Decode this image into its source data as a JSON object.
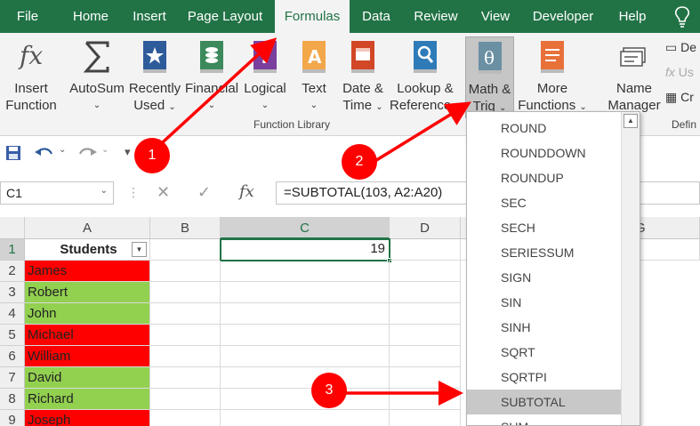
{
  "tabs": [
    "File",
    "Home",
    "Insert",
    "Page Layout",
    "Formulas",
    "Data",
    "Review",
    "View",
    "Developer",
    "Help"
  ],
  "active_tab": "Formulas",
  "ribbon": {
    "insert_function": {
      "line1": "Insert",
      "line2": "Function",
      "icon": "fx-icon"
    },
    "autosum": {
      "line1": "AutoSum",
      "icon": "sigma-icon"
    },
    "recently_used": {
      "line1": "Recently",
      "line2": "Used",
      "icon": "star-book-icon"
    },
    "financial": {
      "line1": "Financial",
      "icon": "coins-book-icon"
    },
    "logical": {
      "line1": "Logical",
      "icon": "question-book-icon"
    },
    "text": {
      "line1": "Text",
      "icon": "a-book-icon"
    },
    "date_time": {
      "line1": "Date &",
      "line2": "Time",
      "icon": "calendar-book-icon"
    },
    "lookup_reference": {
      "line1": "Lookup &",
      "line2": "Reference",
      "icon": "magnifier-book-icon"
    },
    "math_trig": {
      "line1": "Math &",
      "line2": "Trig",
      "icon": "theta-book-icon"
    },
    "more_functions": {
      "line1": "More",
      "line2": "Functions",
      "icon": "more-book-icon"
    },
    "name_manager": {
      "line1": "Name",
      "line2": "Manager",
      "icon": "tags-icon"
    },
    "group_label": "Function Library",
    "defined_names_partial": "Defin",
    "side_items": [
      "De",
      "Us",
      "Cr"
    ]
  },
  "namebox": "C1",
  "formula": "=SUBTOTAL(103, A2:A20)",
  "columns": [
    "A",
    "B",
    "C",
    "D",
    "G"
  ],
  "rows": [
    "1",
    "2",
    "3",
    "4",
    "5",
    "6",
    "7",
    "8",
    "9"
  ],
  "header_cell": "Students",
  "c1_value": "19",
  "students": [
    {
      "name": "James",
      "color": "#ff0000"
    },
    {
      "name": "Robert",
      "color": "#92d050"
    },
    {
      "name": "John",
      "color": "#92d050"
    },
    {
      "name": "Michael",
      "color": "#ff0000"
    },
    {
      "name": "William",
      "color": "#ff0000"
    },
    {
      "name": "David",
      "color": "#92d050"
    },
    {
      "name": "Richard",
      "color": "#92d050"
    },
    {
      "name": "Joseph",
      "color": "#ff0000"
    }
  ],
  "dropdown_items": [
    "ROUND",
    "ROUNDDOWN",
    "ROUNDUP",
    "SEC",
    "SECH",
    "SERIESSUM",
    "SIGN",
    "SIN",
    "SINH",
    "SQRT",
    "SQRTPI",
    "SUBTOTAL",
    "SUM"
  ],
  "dropdown_highlight": "SUBTOTAL",
  "annotations": [
    "1",
    "2",
    "3"
  ],
  "colors": {
    "excel_green": "#217346",
    "annotation_red": "#ff0000",
    "red_fill": "#ff0000",
    "green_fill": "#92d050"
  }
}
